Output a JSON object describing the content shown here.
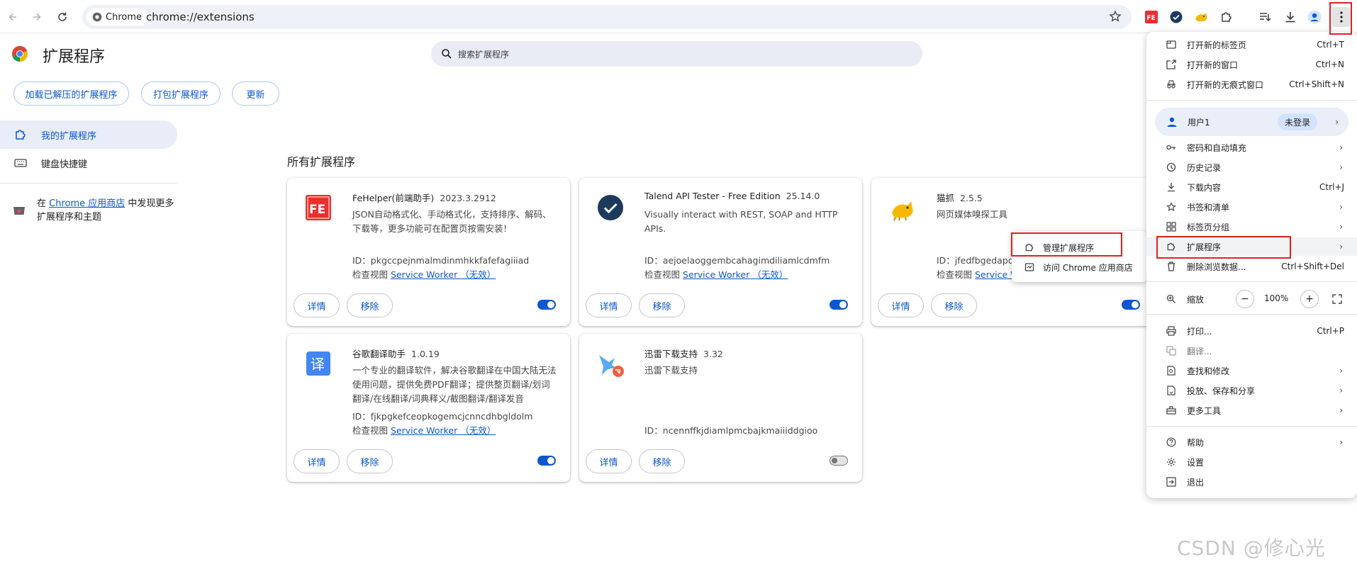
{
  "browser": {
    "site_chip": "Chrome",
    "url": "chrome://extensions"
  },
  "header": {
    "title": "扩展程序",
    "search_placeholder": "搜索扩展程序"
  },
  "dev_buttons": {
    "load_unpacked": "加载已解压的扩展程序",
    "pack": "打包扩展程序",
    "update": "更新"
  },
  "sidebar": {
    "my_extensions": "我的扩展程序",
    "shortcuts": "键盘快捷键",
    "store_prefix": "在",
    "store_link": "Chrome 应用商店",
    "store_suffix": "中发现更多扩展程序和主题"
  },
  "section_title": "所有扩展程序",
  "extensions": [
    {
      "name": "FeHelper(前端助手)",
      "version": "2023.3.2912",
      "description": "JSON自动格式化、手动格式化，支持排序、解码、下载等，更多功能可在配置页按需安装！",
      "id": "ID：pkgccpejnmalmdinmhkkfafefagiiiad",
      "inspect_label": "检查视图",
      "inspect_link": "Service Worker （无效）",
      "details": "详情",
      "remove": "移除",
      "enabled": true
    },
    {
      "name": "Talend API Tester - Free Edition",
      "version": "25.14.0",
      "description": "Visually interact with REST, SOAP and HTTP APIs.",
      "id": "ID：aejoelaoggembcahagimdiliamlcdmfm",
      "inspect_label": "检查视图",
      "inspect_link": "Service Worker （无效）",
      "details": "详情",
      "remove": "移除",
      "enabled": true
    },
    {
      "name": "猫抓",
      "version": "2.5.5",
      "description": "网页媒体嗅探工具",
      "id": "ID：jfedfbgedapd",
      "inspect_label": "检查视图",
      "inspect_link": "Service W",
      "details": "详情",
      "remove": "移除",
      "enabled": true
    },
    {
      "name": "谷歌翻译助手",
      "version": "1.0.19",
      "description": "一个专业的翻译软件，解决谷歌翻译在中国大陆无法使用问题，提供免费PDF翻译；提供整页翻译/划词翻译/在线翻译/词典释义/截图翻译/翻译发音",
      "id": "ID：fjkpgkefceopkogemcjcnncdhbgldolm",
      "inspect_label": "检查视图",
      "inspect_link": "Service Worker （无效）",
      "details": "详情",
      "remove": "移除",
      "enabled": true
    },
    {
      "name": "迅雷下载支持",
      "version": "3.32",
      "description": "迅雷下载支持",
      "id": "ID：ncennffkjdiamlpmcbajkmaiiiddgioo",
      "details": "详情",
      "remove": "移除",
      "enabled": false
    }
  ],
  "submenu": {
    "manage": "管理扩展程序",
    "visit_store": "访问 Chrome 应用商店"
  },
  "menu": {
    "new_tab": "打开新的标签页",
    "new_tab_sc": "Ctrl+T",
    "new_window": "打开新的窗口",
    "new_window_sc": "Ctrl+N",
    "incognito": "打开新的无痕式窗口",
    "incognito_sc": "Ctrl+Shift+N",
    "profile": "用户1",
    "profile_badge": "未登录",
    "passwords": "密码和自动填充",
    "history": "历史记录",
    "downloads": "下载内容",
    "downloads_sc": "Ctrl+J",
    "bookmarks": "书签和清单",
    "tab_groups": "标签页分组",
    "extensions": "扩展程序",
    "clear_data": "删除浏览数据...",
    "clear_data_sc": "Ctrl+Shift+Del",
    "zoom": "缩放",
    "zoom_minus": "−",
    "zoom_value": "100%",
    "zoom_plus": "+",
    "print": "打印...",
    "print_sc": "Ctrl+P",
    "translate": "翻译...",
    "find": "查找和修改",
    "cast": "投放、保存和分享",
    "more_tools": "更多工具",
    "help": "帮助",
    "settings": "设置",
    "exit": "退出"
  },
  "watermark": "CSDN @修心光",
  "colors": {
    "accent": "#0b57d0",
    "highlight": "#e02020"
  }
}
